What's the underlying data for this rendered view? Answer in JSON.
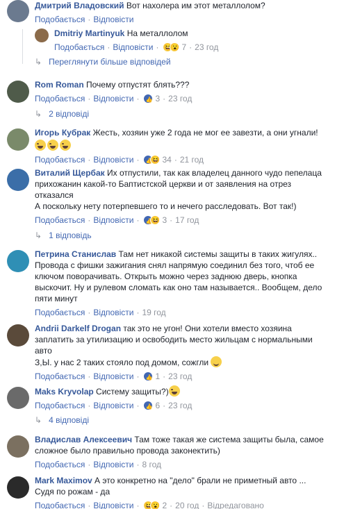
{
  "actions": {
    "like": "Подобається",
    "reply": "Відповісти"
  },
  "comments": [
    {
      "author": "Дмитрий Владовский",
      "text": "Вот нахолера им этот металлолом?",
      "meta_tail": "",
      "reactions": [],
      "count": "",
      "time": "",
      "avatar_color": "#6b7a8f"
    },
    {
      "author": "Dmitriy Martinyuk",
      "text": "На металлолом",
      "reactions": [
        "haha",
        "wow"
      ],
      "count": "7",
      "time": "23 год",
      "avatar_color": "#8b6b4a"
    },
    {
      "author": "Rom Roman",
      "text": "Почему отпустят блять???",
      "reactions": [
        "like"
      ],
      "count": "3",
      "time": "23 год",
      "avatar_color": "#4f5b4a"
    },
    {
      "author": "Игорь Кубрак",
      "text": "Жесть, хозяин уже 2 года не мог ее завезти, а они угнали!",
      "reactions": [
        "like",
        "haha"
      ],
      "count": "34",
      "time": "21 год",
      "avatar_color": "#7a8a6a"
    },
    {
      "author": "Виталий Щербак",
      "text_lines": [
        "Их отпустили, так как владелец данного чудо пепелаца",
        "прихожанин какой-то Баптистской церкви и от заявления на отрез",
        "отказался",
        "А поскольку нету потерпевшего то и нечего расследовать. Вот так!)"
      ],
      "reactions": [
        "like",
        "haha"
      ],
      "count": "3",
      "time": "17 год",
      "avatar_color": "#3b6ea8"
    },
    {
      "author": "Петрина Станислав",
      "text_lines": [
        "Там нет никакой системы защиты в таких жигулях..",
        "Провода с фишки зажигания снял напрямую соединил без того, чтоб ее",
        "ключом поворачивать. Открыть можно через заднюю дверь, кнопка",
        "выскочит. Ну и рулевом сломать как оно там называется.. Вообщем, дело",
        "пяти минут"
      ],
      "reactions": [],
      "count": "",
      "time": "19 год",
      "avatar_color": "#2f8fb5"
    },
    {
      "author": "Andrii Darkelf Drogan",
      "text_lines": [
        "так это не угон! Они хотели вместо хозяина",
        "заплатить за утилизацию и освободить место жильцам с нормальными",
        "авто",
        "З,Ы. у нас 2 таких стояло под домом, сожгли"
      ],
      "reactions": [
        "like"
      ],
      "count": "1",
      "time": "23 год",
      "avatar_color": "#5a4a3a"
    },
    {
      "author": "Maks Kryvolap",
      "text": "Систему защиты?)",
      "reactions": [
        "like"
      ],
      "count": "6",
      "time": "23 год",
      "avatar_color": "#6a6a6a"
    },
    {
      "author": "Владислав Алексеевич",
      "text_lines": [
        "Там тоже такая же система защиты была, самое",
        "сложное было правильно провода законектить)"
      ],
      "reactions": [],
      "count": "",
      "time": "8 год",
      "avatar_color": "#7b7060"
    },
    {
      "author": "Mark Maximov",
      "text_lines": [
        "А это конкретно на \"дело\" брали не приметный авто ...",
        "Судя по рожам - да"
      ],
      "reactions": [
        "haha",
        "wow"
      ],
      "count": "2",
      "time": "20 год",
      "edited": "Відредаговано",
      "avatar_color": "#2a2a2a"
    }
  ],
  "reply_links": {
    "more_replies": "Переглянути більше відповідей",
    "two_replies": "2 відповіді",
    "one_reply": "1 відповідь",
    "four_replies": "4 відповіді"
  },
  "colors": {
    "link": "#365899",
    "action": "#4267b2",
    "meta": "#90949c"
  }
}
